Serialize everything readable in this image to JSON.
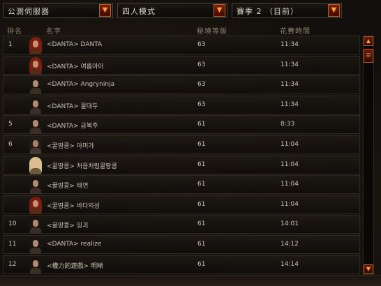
{
  "filters": {
    "server": "公測伺服器",
    "mode": "四人模式",
    "season": "賽季 2 （目前）"
  },
  "header": {
    "rank": "排名",
    "name": "名字",
    "level": "秘境等級",
    "time": "花費時間"
  },
  "rows": [
    {
      "rank": "1",
      "name": "<DANTA> DANTA",
      "level": "63",
      "time": "11:34",
      "avatar": "female-red-hair"
    },
    {
      "rank": "",
      "name": "<DANTA> 여름아이",
      "level": "63",
      "time": "11:34",
      "avatar": "female-red-hair"
    },
    {
      "rank": "",
      "name": "<DANTA> Angryninja",
      "level": "63",
      "time": "11:34",
      "avatar": "female-dark-hair"
    },
    {
      "rank": "",
      "name": "<DANTA> 꿀대두",
      "level": "63",
      "time": "11:34",
      "avatar": "female-dark-hair"
    },
    {
      "rank": "5",
      "name": "<DANTA> 금복주",
      "level": "61",
      "time": "8:33",
      "avatar": "female-dark-hair"
    },
    {
      "rank": "6",
      "name": "<꿀땅콩> 아미가",
      "level": "61",
      "time": "11:04",
      "avatar": "male-dark"
    },
    {
      "rank": "",
      "name": "<꿀땅콩> 처음처럼꿀땅콩",
      "level": "61",
      "time": "11:04",
      "avatar": "female-blonde"
    },
    {
      "rank": "",
      "name": "<꿀땅콩> 태연",
      "level": "61",
      "time": "11:04",
      "avatar": "female-dark-hair"
    },
    {
      "rank": "",
      "name": "<꿀땅콩> 바다의성",
      "level": "61",
      "time": "11:04",
      "avatar": "female-red-hair"
    },
    {
      "rank": "10",
      "name": "<꿀땅콩> 잉괴",
      "level": "61",
      "time": "14:01",
      "avatar": "female-dark-hair"
    },
    {
      "rank": "11",
      "name": "<DANTA> realize",
      "level": "61",
      "time": "14:12",
      "avatar": "female-dark-hair"
    },
    {
      "rank": "12",
      "name": "<權力的遊戲> 明晰",
      "level": "61",
      "time": "14:14",
      "avatar": "female-dark-hair"
    }
  ],
  "icons": {
    "dropdown_arrow": "▼",
    "scroll_up": "▲",
    "scroll_down": "▼",
    "scroll_thumb": "☰"
  },
  "colors": {
    "accent_orange": "#f0a040",
    "button_red": "#7a1e0a",
    "text": "#c9c2b4"
  }
}
